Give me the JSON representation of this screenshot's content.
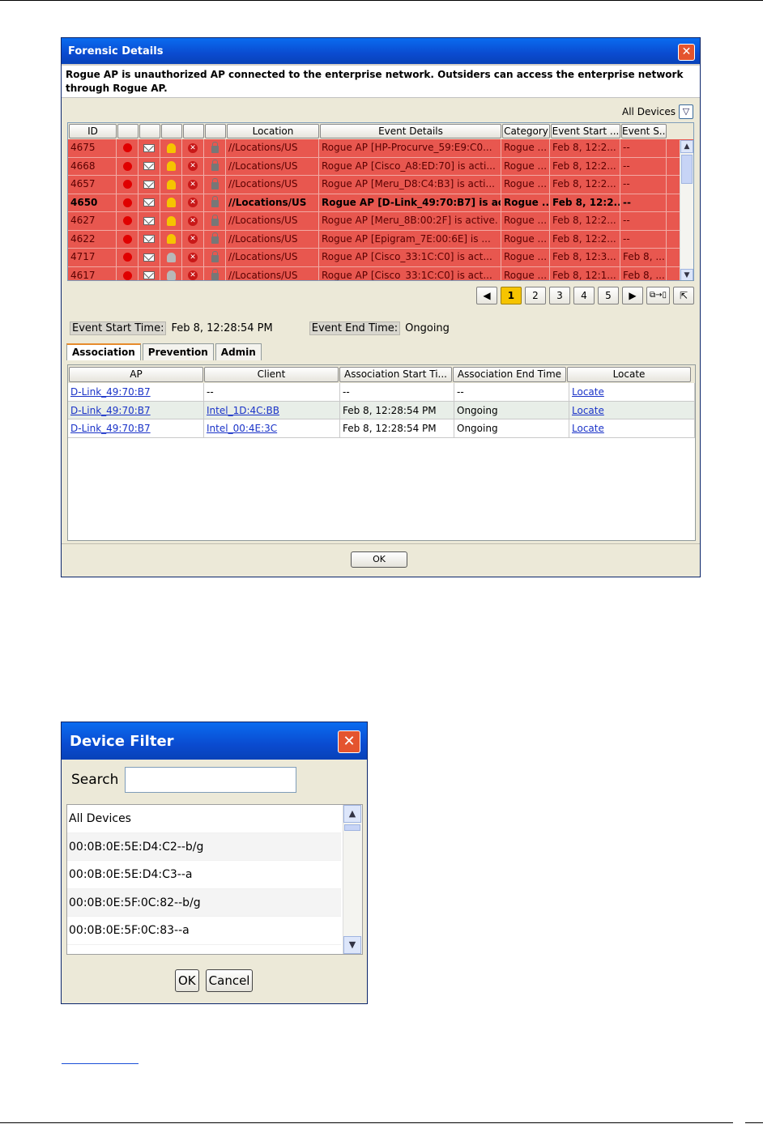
{
  "forensic": {
    "title": "Forensic Details",
    "close": "✕",
    "message": "Rogue AP is unauthorized AP connected to the enterprise network. Outsiders can access the enterprise network through Rogue AP.",
    "filter_label": "All Devices",
    "headers": [
      "ID",
      "",
      "",
      "",
      "",
      "",
      "Location",
      "Event Details",
      "Category",
      "Event Start ...",
      "Event S..."
    ],
    "rows": [
      {
        "id": "4675",
        "location": "//Locations/US",
        "details": "Rogue AP [HP-Procurve_59:E9:C0...",
        "category": "Rogue ...",
        "start": "Feb 8, 12:2...",
        "end": "--",
        "bell": "yellow",
        "bold": false
      },
      {
        "id": "4668",
        "location": "//Locations/US",
        "details": "Rogue AP [Cisco_A8:ED:70] is acti...",
        "category": "Rogue ...",
        "start": "Feb 8, 12:2...",
        "end": "--",
        "bell": "yellow",
        "bold": false
      },
      {
        "id": "4657",
        "location": "//Locations/US",
        "details": "Rogue AP [Meru_D8:C4:B3] is acti...",
        "category": "Rogue ...",
        "start": "Feb 8, 12:2...",
        "end": "--",
        "bell": "yellow",
        "bold": false
      },
      {
        "id": "4650",
        "location": "//Locations/US",
        "details": "Rogue AP [D-Link_49:70:B7] is ac...",
        "category": "Rogue ...",
        "start": "Feb 8, 12:2...",
        "end": "--",
        "bell": "yellow",
        "bold": true
      },
      {
        "id": "4627",
        "location": "//Locations/US",
        "details": "Rogue AP [Meru_8B:00:2F] is active.",
        "category": "Rogue ...",
        "start": "Feb 8, 12:2...",
        "end": "--",
        "bell": "yellow",
        "bold": false
      },
      {
        "id": "4622",
        "location": "//Locations/US",
        "details": "Rogue AP [Epigram_7E:00:6E] is ...",
        "category": "Rogue ...",
        "start": "Feb 8, 12:2...",
        "end": "--",
        "bell": "yellow",
        "bold": false
      },
      {
        "id": "4717",
        "location": "//Locations/US",
        "details": "Rogue AP [Cisco_33:1C:C0] is act...",
        "category": "Rogue ...",
        "start": "Feb 8, 12:3...",
        "end": "Feb 8, ...",
        "bell": "grey",
        "bold": false
      },
      {
        "id": "4617",
        "location": "//Locations/US",
        "details": "Rogue AP [Cisco_33:1C:C0] is act...",
        "category": "Rogue ...",
        "start": "Feb 8, 12:1...",
        "end": "Feb 8, ...",
        "bell": "grey",
        "bold": false
      }
    ],
    "pager": {
      "prev": "◀",
      "pages": [
        "1",
        "2",
        "3",
        "4",
        "5"
      ],
      "active": "1",
      "next": "▶"
    },
    "event_start_label": "Event Start Time:",
    "event_start_value": "Feb 8, 12:28:54 PM",
    "event_end_label": "Event End Time:",
    "event_end_value": "Ongoing",
    "tabs": [
      "Association",
      "Prevention",
      "Admin"
    ],
    "assoc_headers": [
      "AP",
      "Client",
      "Association Start Ti...",
      "Association End Time",
      "Locate"
    ],
    "assoc_rows": [
      [
        "D-Link_49:70:B7",
        "--",
        "--",
        "--",
        "Locate"
      ],
      [
        "D-Link_49:70:B7",
        "Intel_1D:4C:BB",
        "Feb 8, 12:28:54 PM",
        "Ongoing",
        "Locate"
      ],
      [
        "D-Link_49:70:B7",
        "Intel_00:4E:3C",
        "Feb 8, 12:28:54 PM",
        "Ongoing",
        "Locate"
      ]
    ],
    "ok": "OK",
    "row_color": "#e8574f"
  },
  "device_filter": {
    "title": "Device Filter",
    "close": "✕",
    "search_label": "Search",
    "search_value": "",
    "items": [
      "All Devices",
      "00:0B:0E:5E:D4:C2--b/g",
      "00:0B:0E:5E:D4:C3--a",
      "00:0B:0E:5F:0C:82--b/g",
      "00:0B:0E:5F:0C:83--a"
    ],
    "ok": "OK",
    "cancel": "Cancel"
  }
}
